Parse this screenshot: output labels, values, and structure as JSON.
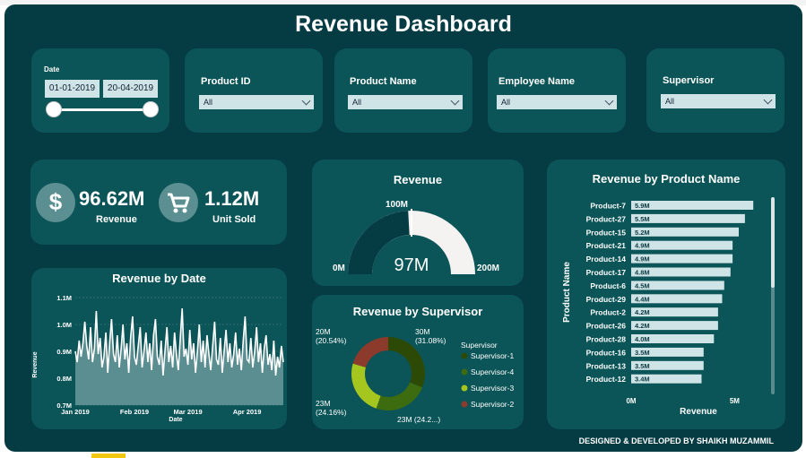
{
  "title": "Revenue Dashboard",
  "filters": {
    "date": {
      "label": "Date",
      "start": "01-01-2019",
      "end": "20-04-2019"
    },
    "product_id": {
      "label": "Product ID",
      "value": "All"
    },
    "product_name": {
      "label": "Product Name",
      "value": "All"
    },
    "employee_name": {
      "label": "Employee Name",
      "value": "All"
    },
    "supervisor": {
      "label": "Supervisor",
      "value": "All"
    }
  },
  "kpis": {
    "revenue": {
      "value": "96.62M",
      "label": "Revenue",
      "icon": "dollar-icon",
      "icon_glyph": "$"
    },
    "unit_sold": {
      "value": "1.12M",
      "label": "Unit Sold",
      "icon": "shopping-cart-icon"
    }
  },
  "gauge": {
    "title": "Revenue",
    "min_label": "0M",
    "max_label": "200M",
    "target_label": "100M",
    "value_label": "97M",
    "min": 0,
    "max": 200,
    "value": 96.62,
    "target": 100
  },
  "supervisor_chart": {
    "title": "Revenue by Supervisor",
    "legend_title": "Supervisor"
  },
  "date_chart": {
    "title": "Revenue by Date",
    "xlabel": "Date",
    "ylabel": "Revenue"
  },
  "product_chart": {
    "title": "Revenue by Product Name",
    "xlabel": "Revenue",
    "ylabel": "Product Name"
  },
  "colors": {
    "background": "#053c44",
    "card": "#0b5457",
    "bar": "#cfe4e7",
    "gauge_fill": "#053c44",
    "gauge_track": "#f5f2f2"
  },
  "footer": "DESIGNED & DEVELOPED BY SHAIKH MUZAMMIL",
  "chart_data": [
    {
      "type": "donut",
      "title": "Revenue by Supervisor",
      "legend_title": "Supervisor",
      "legend": "right",
      "series": [
        {
          "name": "Supervisor-1",
          "value": 30,
          "label": "30M",
          "pct_label": "(31.08%)",
          "color": "#2c4a06"
        },
        {
          "name": "Supervisor-4",
          "value": 23.38,
          "label": "23M (24.2...)",
          "pct_label": "",
          "color": "#3d6b10"
        },
        {
          "name": "Supervisor-3",
          "value": 23.34,
          "label": "23M",
          "pct_label": "(24.16%)",
          "color": "#a4c61f"
        },
        {
          "name": "Supervisor-2",
          "value": 19.84,
          "label": "20M",
          "pct_label": "(20.54%)",
          "color": "#8b3a2b"
        }
      ]
    },
    {
      "type": "area",
      "title": "Revenue by Date",
      "xlabel": "Date",
      "ylabel": "Revenue",
      "xlim": [
        "2019-01-01",
        "2019-04-20"
      ],
      "x_ticks": [
        {
          "date": "2019-01-01",
          "label": "Jan 2019"
        },
        {
          "date": "2019-02-01",
          "label": "Feb 2019"
        },
        {
          "date": "2019-03-01",
          "label": "Mar 2019"
        },
        {
          "date": "2019-04-01",
          "label": "Apr 2019"
        }
      ],
      "ylim": [
        0.7,
        1.1
      ],
      "y_ticks": [
        {
          "value": 0.7,
          "label": "0.7M"
        },
        {
          "value": 0.8,
          "label": "0.8M"
        },
        {
          "value": 0.9,
          "label": "0.9M"
        },
        {
          "value": 1.0,
          "label": "1.0M"
        },
        {
          "value": 1.1,
          "label": "1.1M"
        }
      ],
      "grid": true,
      "y_unit": "M",
      "values": [
        0.9,
        0.86,
        0.94,
        0.88,
        0.93,
        1.01,
        0.92,
        0.87,
        0.99,
        0.86,
        0.91,
        1.05,
        0.89,
        0.95,
        0.84,
        0.88,
        0.97,
        0.82,
        0.93,
        1.02,
        0.89,
        0.86,
        0.96,
        0.84,
        0.91,
        1.0,
        0.87,
        0.93,
        0.82,
        0.95,
        1.03,
        0.88,
        0.85,
        0.92,
        0.99,
        0.84,
        0.9,
        0.97,
        0.86,
        0.93,
        0.83,
        0.96,
        1.02,
        0.88,
        0.85,
        0.94,
        0.81,
        0.9,
        0.99,
        0.86,
        0.92,
        0.84,
        0.97,
        0.89,
        0.83,
        0.95,
        1.06,
        0.88,
        0.91,
        0.85,
        0.98,
        0.87,
        0.93,
        0.82,
        0.9,
        1.0,
        0.86,
        0.94,
        0.84,
        0.96,
        0.89,
        0.83,
        0.92,
        1.01,
        0.87,
        0.85,
        0.95,
        0.82,
        0.9,
        0.98,
        0.86,
        0.93,
        0.84,
        0.89,
        0.97,
        0.85,
        0.91,
        0.83,
        0.94,
        1.03,
        0.87,
        0.86,
        0.95,
        0.84,
        0.9,
        0.99,
        0.86,
        0.93,
        0.82,
        0.91,
        0.96,
        0.85,
        0.89,
        0.83,
        0.94,
        0.81,
        0.88,
        0.84,
        0.92,
        0.86
      ]
    },
    {
      "type": "bar",
      "orientation": "horizontal",
      "title": "Revenue by Product Name",
      "xlabel": "Revenue",
      "ylabel": "Product Name",
      "xlim": [
        0,
        6.5
      ],
      "x_ticks": [
        {
          "value": 0,
          "label": "0M"
        },
        {
          "value": 5,
          "label": "5M"
        }
      ],
      "categories": [
        "Product-7",
        "Product-27",
        "Product-15",
        "Product-21",
        "Product-14",
        "Product-17",
        "Product-6",
        "Product-29",
        "Product-2",
        "Product-26",
        "Product-28",
        "Product-16",
        "Product-13",
        "Product-12"
      ],
      "values": [
        5.9,
        5.5,
        5.2,
        4.9,
        4.9,
        4.8,
        4.5,
        4.4,
        4.2,
        4.2,
        4.0,
        3.5,
        3.5,
        3.4
      ],
      "data_labels": [
        "5.9M",
        "5.5M",
        "5.2M",
        "4.9M",
        "4.9M",
        "4.8M",
        "4.5M",
        "4.4M",
        "4.2M",
        "4.2M",
        "4.0M",
        "3.5M",
        "3.5M",
        "3.4M"
      ]
    }
  ]
}
